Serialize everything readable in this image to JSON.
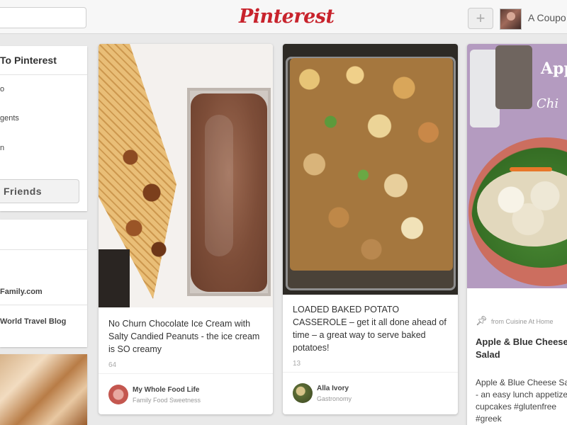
{
  "header": {
    "logo": "Pinterest",
    "add_label": "+",
    "user_name": "A Coupo"
  },
  "sidebar": {
    "title": "To Pinterest",
    "items": [
      "o",
      "gents",
      "n"
    ],
    "friends_button": "Friends",
    "links": [
      "Family.com",
      "World Travel Blog"
    ]
  },
  "pins": [
    {
      "description": "No Churn Chocolate Ice Cream with Salty Candied Peanuts - the ice cream is SO creamy",
      "stats": "64",
      "user": "My Whole Food Life",
      "board": "Family Food Sweetness"
    },
    {
      "description": "LOADED BAKED POTATO CASSEROLE – get it all done ahead of time – a great way to serve baked potatoes!",
      "stats": "13",
      "user": "Alla Ivory",
      "board": "Gastronomy"
    },
    {
      "image_title": "Apple",
      "image_subtitle": "Chi",
      "via": "from Cuisine At Home",
      "title": "Apple & Blue Cheese Salad",
      "description": "Apple & Blue Cheese Salad - an easy lunch appetizer | cupcakes #glutenfree #greek"
    }
  ],
  "colors": {
    "brand": "#c8232c",
    "background": "#e9e9e9"
  },
  "icons": {
    "pin_icon": "pushpin-icon"
  }
}
